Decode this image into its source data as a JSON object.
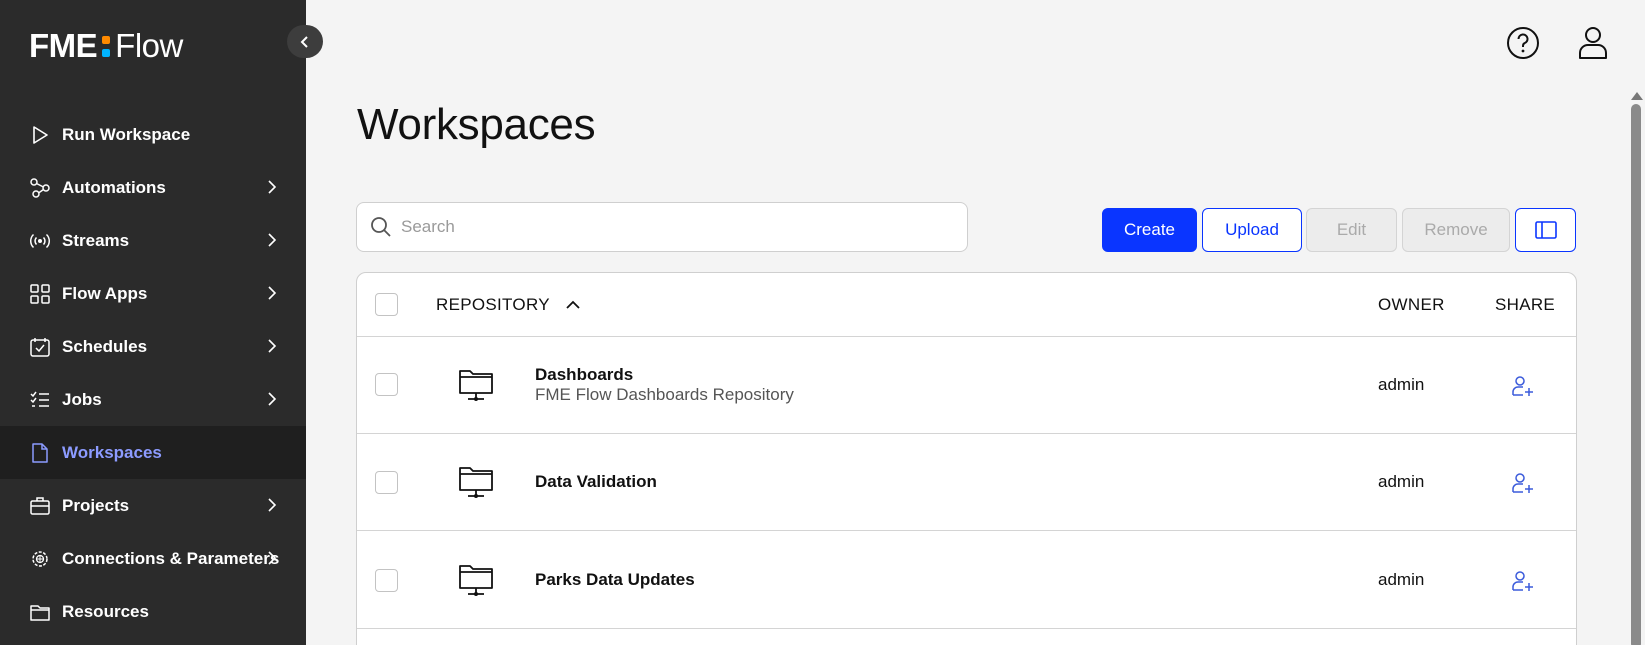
{
  "app": {
    "logo_left": "FME",
    "logo_right": "Flow",
    "logo_dot_colors": [
      "#ff8a00",
      "#00b4ff"
    ]
  },
  "sidebar": {
    "items": [
      {
        "label": "Run Workspace",
        "icon": "play-icon",
        "has_chevron": false
      },
      {
        "label": "Automations",
        "icon": "automations-icon",
        "has_chevron": true
      },
      {
        "label": "Streams",
        "icon": "broadcast-icon",
        "has_chevron": true
      },
      {
        "label": "Flow Apps",
        "icon": "apps-grid-icon",
        "has_chevron": true
      },
      {
        "label": "Schedules",
        "icon": "calendar-check-icon",
        "has_chevron": true
      },
      {
        "label": "Jobs",
        "icon": "checklist-icon",
        "has_chevron": true
      },
      {
        "label": "Workspaces",
        "icon": "document-icon",
        "has_chevron": false,
        "active": true
      },
      {
        "label": "Projects",
        "icon": "briefcase-icon",
        "has_chevron": true
      },
      {
        "label": "Connections & Parameters",
        "icon": "gear-globe-icon",
        "has_chevron": true
      },
      {
        "label": "Resources",
        "icon": "folder-icon",
        "has_chevron": false
      }
    ]
  },
  "header": {
    "help_icon": "help-circle-icon",
    "user_icon": "user-icon"
  },
  "main": {
    "title": "Workspaces",
    "search_placeholder": "Search",
    "search_value": "",
    "buttons": {
      "create": "Create",
      "upload": "Upload",
      "edit": "Edit",
      "remove": "Remove"
    },
    "table": {
      "columns": {
        "repository": "REPOSITORY",
        "owner": "OWNER",
        "share": "SHARE"
      },
      "sort": "ascending",
      "rows": [
        {
          "name": "Dashboards",
          "description": "FME Flow Dashboards Repository",
          "owner": "admin"
        },
        {
          "name": "Data Validation",
          "description": "",
          "owner": "admin"
        },
        {
          "name": "Parks Data Updates",
          "description": "",
          "owner": "admin"
        }
      ]
    }
  },
  "colors": {
    "sidebar_bg": "#2b2b2b",
    "active_item_text": "#8c9bff",
    "primary": "#0a35ff",
    "share_icon": "#3b5bdb"
  }
}
